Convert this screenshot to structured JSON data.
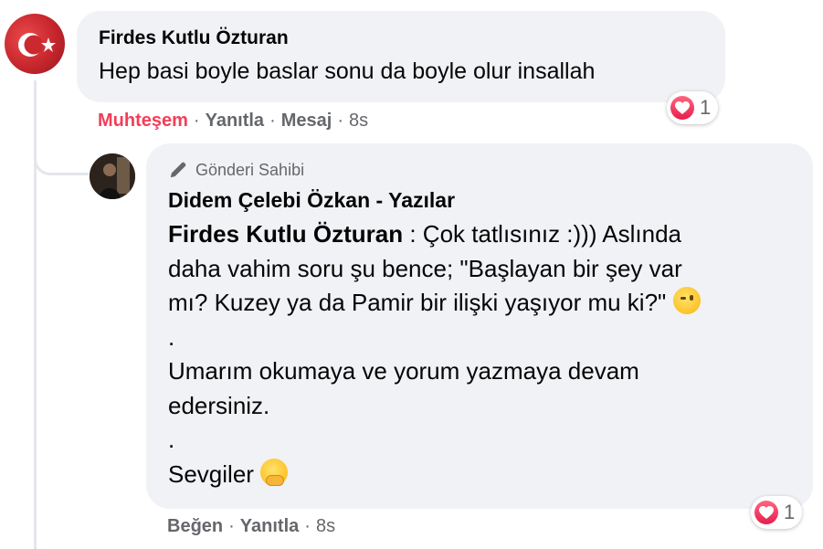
{
  "comment": {
    "author": "Firdes Kutlu Özturan",
    "text": "Hep basi boyle baslar sonu da boyle olur insallah",
    "reaction_count": "1",
    "actions": {
      "reaction_label": "Muhteşem",
      "reply_label": "Yanıtla",
      "message_label": "Mesaj",
      "time": "8s"
    }
  },
  "reply": {
    "badge": "Gönderi Sahibi",
    "author": "Didem Çelebi Özkan - Yazılar",
    "mention": "Firdes Kutlu Özturan",
    "lines": [
      " : Çok tatlısınız :))) Aslında",
      "daha vahim soru şu bence; \"Başlayan bir şey var",
      "mı? Kuzey ya da Pamir bir ilişki yaşıyor mu ki?\" ",
      ".",
      "Umarım okumaya ve yorum yazmaya devam",
      "edersiniz.",
      ".",
      "Sevgiler "
    ],
    "reaction_count": "1",
    "actions": {
      "like_label": "Beğen",
      "reply_label": "Yanıtla",
      "time": "8s"
    }
  },
  "separator": "·",
  "colors": {
    "bubble": "#f0f2f5",
    "muted_text": "#65676b",
    "love_reaction": "#f33e58"
  },
  "icons": [
    "heart-reaction-icon",
    "pencil-icon",
    "winking-face-emoji",
    "hugging-face-emoji"
  ]
}
